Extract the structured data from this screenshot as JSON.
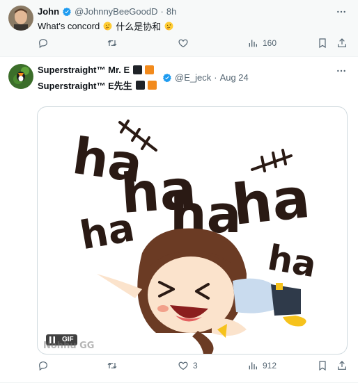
{
  "posts": [
    {
      "author_name": "John",
      "handle": "@JohnnyBeeGoodD",
      "separator": "·",
      "time": "8h",
      "text_a": "What's concord",
      "text_b": "什么是协和",
      "emoji": "thinking-face",
      "actions": {
        "reply": "",
        "repost": "",
        "like": "",
        "views": "160"
      }
    },
    {
      "author_name_line1": "Superstraight™ Mr. E",
      "author_name_line2": "Superstraight™ E先生",
      "handle": "@E_jeck",
      "separator": "·",
      "time": "Aug 24",
      "flag_colors": [
        "#1f2328",
        "#f28a1c"
      ],
      "media": {
        "type": "gif",
        "badge": "GIF",
        "watermark": "Nohhu GG",
        "laughs": [
          "ha",
          "ha",
          "ha",
          "ha",
          "ha",
          "ha"
        ]
      },
      "actions": {
        "reply": "",
        "repost": "",
        "like": "3",
        "views": "912"
      }
    }
  ],
  "colors": {
    "verified": "#1d9bf0",
    "muted": "#536471",
    "ink": "#2a1a14"
  }
}
